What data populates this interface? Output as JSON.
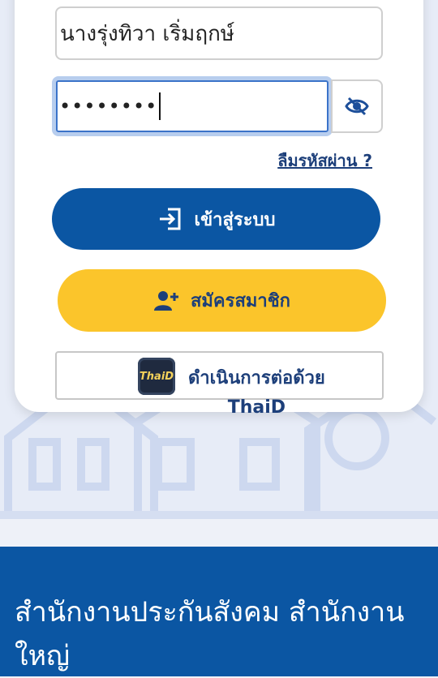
{
  "login": {
    "username_value": "นางรุ่งทิวา เริ่มฤกษ์",
    "password_value": "••••••••",
    "forgot_label": "ลืมรหัสผ่าน ?",
    "login_label": "เข้าสู่ระบบ",
    "register_label": "สมัครสมาชิก",
    "thaid_label_line1": "ดำเนินการต่อด้วย",
    "thaid_label_line2": "ThaiD",
    "thaid_logo_text": "ThaiD"
  },
  "footer": {
    "title": "สำนักงานประกันสังคม สำนักงานใหญ่"
  },
  "icons": {
    "eye": "eye-slash-icon",
    "login": "sign-in-icon",
    "register": "user-plus-icon"
  },
  "colors": {
    "primary": "#0b56a3",
    "accent": "#fbc52b",
    "link": "#1d3f7a",
    "background": "#eef1f8"
  }
}
